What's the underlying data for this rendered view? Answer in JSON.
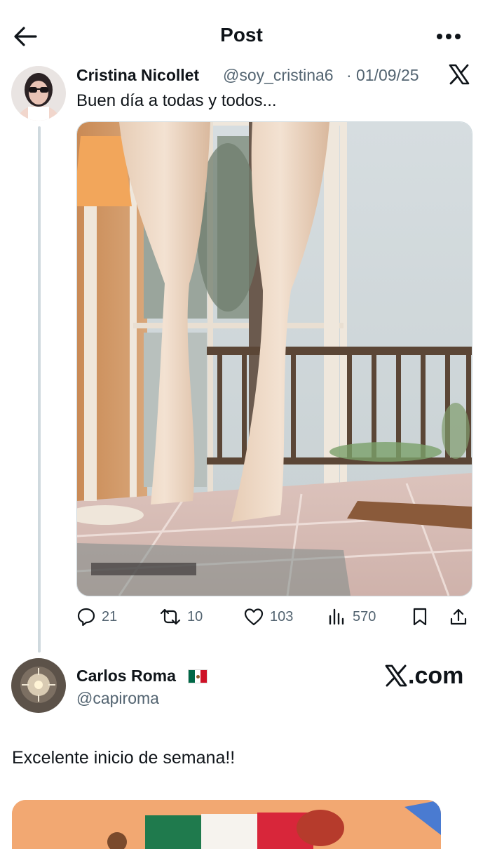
{
  "header": {
    "title": "Post"
  },
  "post": {
    "author_name": "Cristina Nicollet",
    "handle": "@soy_cristina6",
    "separator": "·",
    "date": "01/09/25",
    "text": "Buen día a todas y todos...",
    "actions": {
      "replies": "21",
      "reposts": "10",
      "likes": "103",
      "views": "570"
    }
  },
  "reply": {
    "author_name": "Carlos Roma",
    "flag_icon": "mexico-flag-icon",
    "handle": "@capiroma",
    "brand": ".com",
    "text": "Excelente inicio de semana!!"
  },
  "colors": {
    "text": "#0f1419",
    "secondary": "#536471",
    "divider": "#cfd9de"
  }
}
